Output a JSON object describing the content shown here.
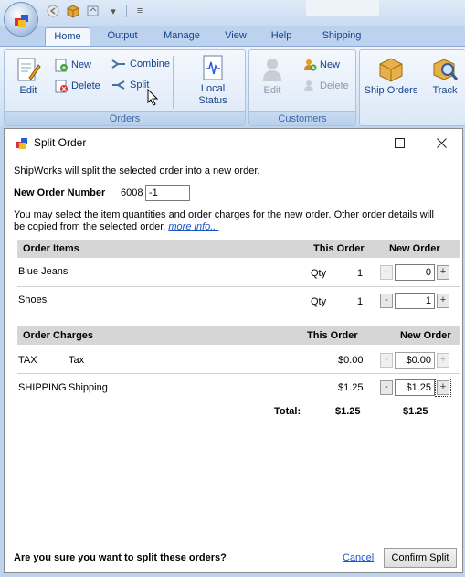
{
  "ribbon": {
    "tabs": [
      "Home",
      "Output",
      "Manage",
      "View",
      "Help",
      "Shipping"
    ],
    "active_tab": "Home",
    "groups": {
      "orders": {
        "label": "Orders",
        "edit": "Edit",
        "new": "New",
        "delete": "Delete",
        "combine": "Combine",
        "split": "Split",
        "local_status": "Local\nStatus"
      },
      "customers": {
        "label": "Customers",
        "edit": "Edit",
        "new": "New",
        "delete": "Delete"
      },
      "shipping": {
        "ship_orders": "Ship Orders",
        "track": "Track"
      }
    }
  },
  "dialog": {
    "title": "Split Order",
    "intro": "ShipWorks will split the selected order into a new order.",
    "new_order_label": "New Order Number",
    "order_number": "6008",
    "order_suffix": "-1",
    "instructions_line1": "You may select the item quantities and order charges for the new order.  Other order details will",
    "instructions_line2": "be copied from the selected order.",
    "more_info": "more info...",
    "items_table": {
      "headers": [
        "Order Items",
        "This Order",
        "New Order"
      ],
      "rows": [
        {
          "name": "Blue Jeans",
          "qty_label": "Qty",
          "this_order": "1",
          "new_order": "0"
        },
        {
          "name": "Shoes",
          "qty_label": "Qty",
          "this_order": "1",
          "new_order": "1"
        }
      ]
    },
    "charges_table": {
      "headers": [
        "Order Charges",
        "This Order",
        "New Order"
      ],
      "rows": [
        {
          "code": "TAX",
          "name": "Tax",
          "this_order": "$0.00",
          "new_order": "$0.00"
        },
        {
          "code": "SHIPPING",
          "name": "Shipping",
          "this_order": "$1.25",
          "new_order": "$1.25"
        }
      ],
      "total_label": "Total:",
      "total_this": "$1.25",
      "total_new": "$1.25"
    },
    "confirm_question": "Are you sure you want to split these orders?",
    "cancel_label": "Cancel",
    "confirm_label": "Confirm Split"
  }
}
